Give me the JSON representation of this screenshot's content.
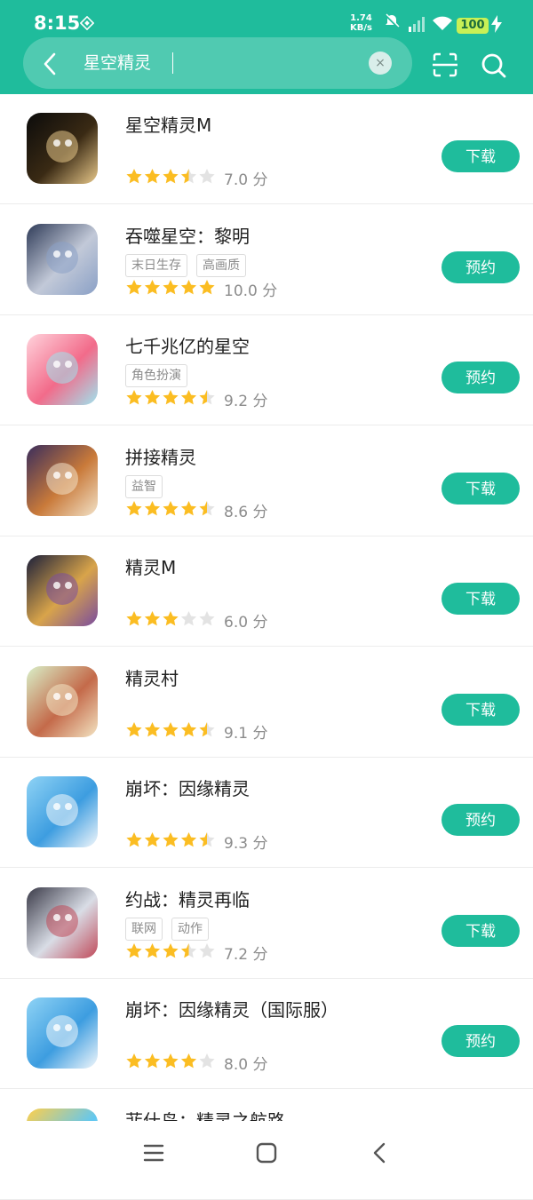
{
  "status_bar": {
    "time": "8:15",
    "net_speed": "1.74",
    "net_unit": "KB/s",
    "battery": "100"
  },
  "search": {
    "query": "星空精灵",
    "clear_icon": "clear-icon",
    "scan_icon": "scan-icon",
    "search_icon": "search-icon"
  },
  "colors": {
    "accent": "#1fbc9c",
    "star_on": "#fbbd22",
    "star_off": "#e3e3e3"
  },
  "results": [
    {
      "name": "星空精灵M",
      "tags": [],
      "rating": 3.5,
      "score": "7.0 分",
      "action": "下载"
    },
    {
      "name": "吞噬星空：黎明",
      "tags": [
        "末日生存",
        "高画质"
      ],
      "rating": 5,
      "score": "10.0 分",
      "action": "预约"
    },
    {
      "name": "七千兆亿的星空",
      "tags": [
        "角色扮演"
      ],
      "rating": 4.5,
      "score": "9.2 分",
      "action": "预约"
    },
    {
      "name": "拼接精灵",
      "tags": [
        "益智"
      ],
      "rating": 4.5,
      "score": "8.6 分",
      "action": "下载"
    },
    {
      "name": "精灵M",
      "tags": [],
      "rating": 3,
      "score": "6.0 分",
      "action": "下载"
    },
    {
      "name": "精灵村",
      "tags": [],
      "rating": 4.5,
      "score": "9.1 分",
      "action": "下载"
    },
    {
      "name": "崩坏：因缘精灵",
      "tags": [],
      "rating": 4.5,
      "score": "9.3 分",
      "action": "预约"
    },
    {
      "name": "约战：精灵再临",
      "tags": [
        "联网",
        "动作"
      ],
      "rating": 3.5,
      "score": "7.2 分",
      "action": "下载"
    },
    {
      "name": "崩坏：因缘精灵（国际服）",
      "tags": [],
      "rating": 4,
      "score": "8.0 分",
      "action": "预约"
    },
    {
      "name": "菲什岛：精灵之航路",
      "tags": [],
      "rating": 0,
      "score": "",
      "action": ""
    }
  ],
  "navbar": {
    "menu_icon": "menu-icon",
    "home_icon": "home-icon",
    "back_icon": "back-icon"
  }
}
